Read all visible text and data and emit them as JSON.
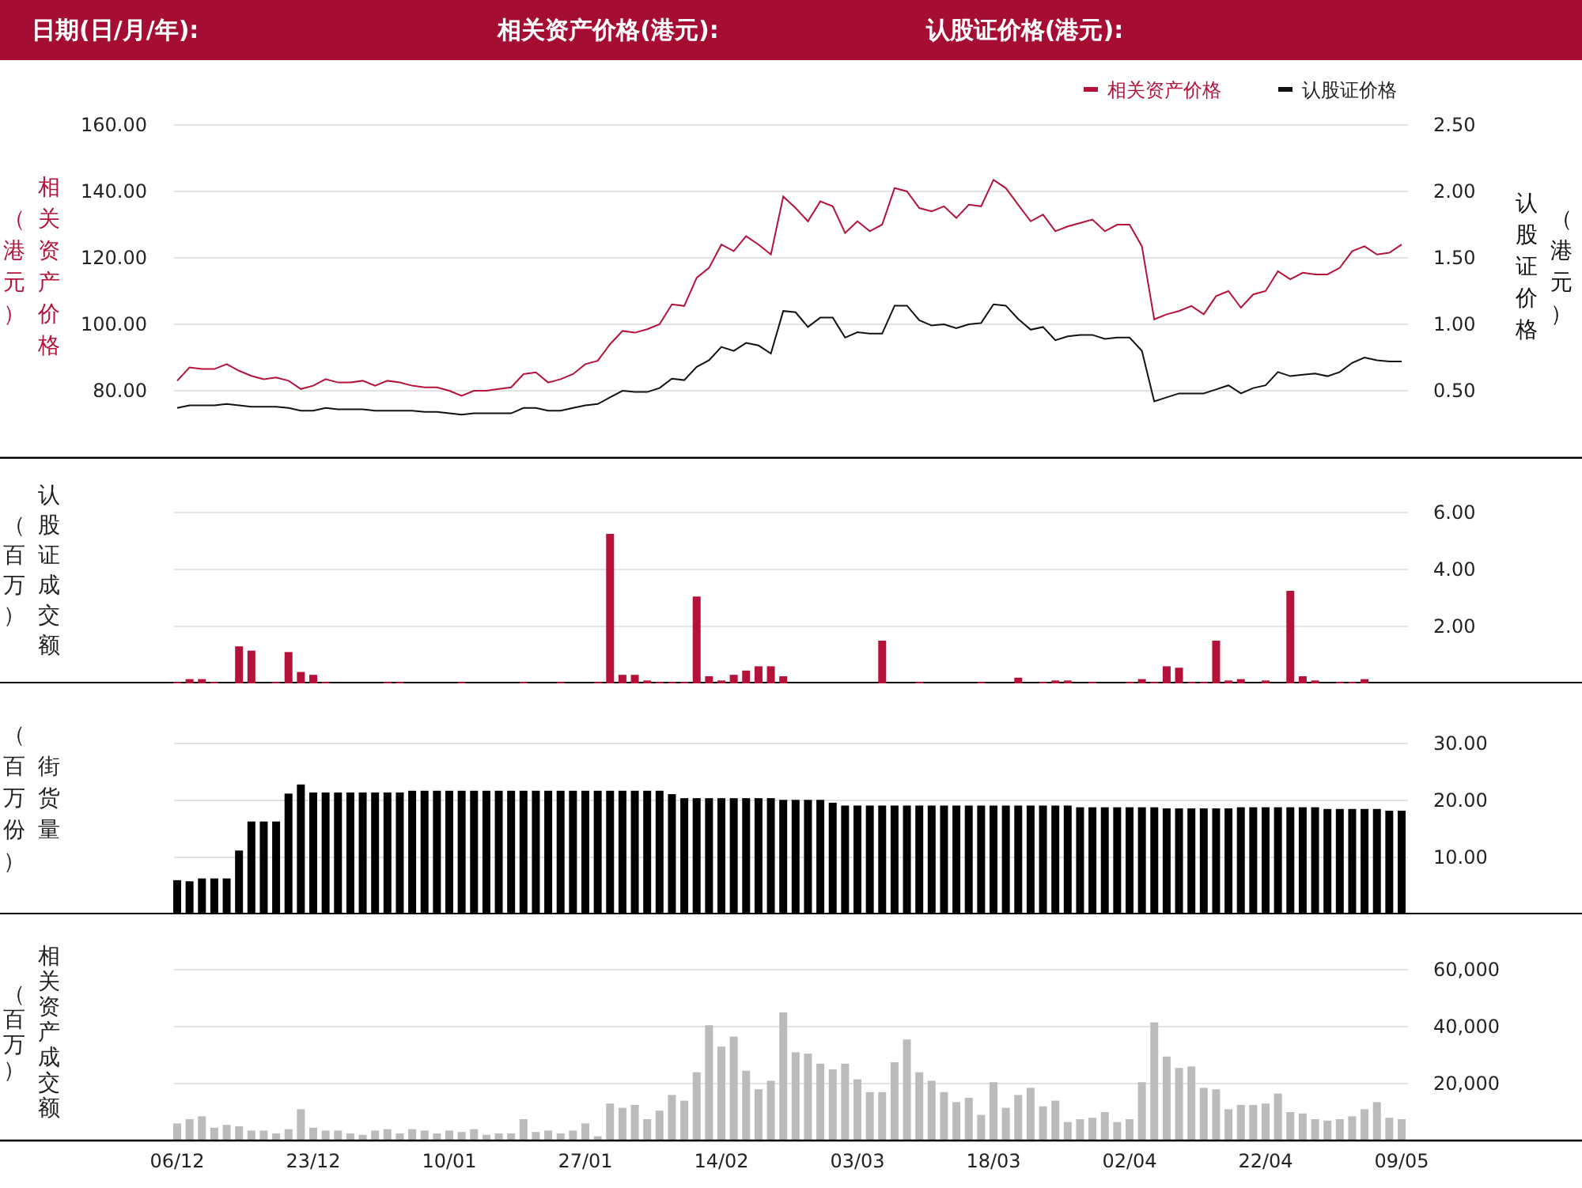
{
  "header": {
    "fields": [
      {
        "label": "日期(日/月/年):"
      },
      {
        "label": "相关资产价格(港元):"
      },
      {
        "label": "认股证价格(港元):"
      }
    ]
  },
  "price_chart": {
    "left_unit": "（港元）",
    "right_unit": "（港元）",
    "charts": [
      {
        "chart_data": {
          "type": "line",
          "ylabel": "相关资产价格",
          "legend": "top-right",
          "grid": true,
          "ylim": [
            60,
            160
          ],
          "yticks": [
            {
              "value": 80,
              "label": "80.00"
            },
            {
              "value": 100,
              "label": "100.00"
            },
            {
              "value": 120,
              "label": "120.00"
            },
            {
              "value": 140,
              "label": "140.00"
            },
            {
              "value": 160,
              "label": "160.00"
            }
          ],
          "series": [
            {
              "name": "相关资产价格",
              "color": "#b5123a",
              "values": [
                83,
                87,
                86.5,
                86.5,
                88,
                86,
                84.5,
                83.5,
                84,
                83,
                80.5,
                81.5,
                83.5,
                82.5,
                82.5,
                83,
                81.5,
                83,
                82.5,
                81.5,
                81,
                81,
                80,
                78.5,
                80,
                80,
                80.5,
                81,
                85,
                85.5,
                82.5,
                83.5,
                85,
                88,
                89,
                94,
                98,
                97.5,
                98.5,
                100,
                106,
                105.5,
                114,
                117,
                124,
                122,
                126.5,
                124,
                121,
                138.5,
                135,
                131,
                137,
                135.5,
                127.5,
                131,
                128,
                130,
                141,
                140,
                135,
                134,
                135.5,
                132,
                136,
                135.5,
                143.5,
                141,
                136,
                131,
                133,
                128,
                129.5,
                130.5,
                131.5,
                128,
                130,
                130,
                123.5,
                101.5,
                103,
                104,
                105.5,
                103,
                108.5,
                110,
                105,
                109,
                110,
                116,
                113.5,
                115.5,
                115,
                115,
                117,
                122,
                123.5,
                121,
                121.5,
                124
              ]
            }
          ]
        }
      },
      {
        "chart_data": {
          "type": "line",
          "ylabel": "认股证价格",
          "legend": "top-right",
          "ylim": [
            0,
            2.5
          ],
          "yticks": [
            {
              "value": 0.5,
              "label": "0.50"
            },
            {
              "value": 1,
              "label": "1.00"
            },
            {
              "value": 1.5,
              "label": "1.50"
            },
            {
              "value": 2,
              "label": "2.00"
            },
            {
              "value": 2.5,
              "label": "2.50"
            }
          ],
          "series": [
            {
              "name": "认股证价格",
              "color": "#111111",
              "values": [
                0.37,
                0.39,
                0.39,
                0.39,
                0.4,
                0.39,
                0.38,
                0.38,
                0.38,
                0.37,
                0.35,
                0.35,
                0.37,
                0.36,
                0.36,
                0.36,
                0.35,
                0.35,
                0.35,
                0.35,
                0.34,
                0.34,
                0.33,
                0.32,
                0.33,
                0.33,
                0.33,
                0.33,
                0.37,
                0.37,
                0.35,
                0.35,
                0.37,
                0.39,
                0.4,
                0.45,
                0.5,
                0.49,
                0.49,
                0.52,
                0.59,
                0.58,
                0.68,
                0.73,
                0.83,
                0.8,
                0.86,
                0.84,
                0.78,
                1.1,
                1.09,
                0.98,
                1.05,
                1.05,
                0.9,
                0.94,
                0.93,
                0.93,
                1.14,
                1.14,
                1.03,
                0.99,
                1,
                0.97,
                1,
                1.01,
                1.15,
                1.14,
                1.04,
                0.96,
                0.98,
                0.88,
                0.91,
                0.92,
                0.92,
                0.89,
                0.9,
                0.9,
                0.8,
                0.42,
                0.45,
                0.48,
                0.48,
                0.48,
                0.51,
                0.54,
                0.48,
                0.52,
                0.54,
                0.64,
                0.61,
                0.62,
                0.63,
                0.61,
                0.64,
                0.71,
                0.75,
                0.73,
                0.72,
                0.72
              ]
            }
          ]
        }
      }
    ]
  },
  "warrant_turnover_chart": {
    "unit": "（百万）",
    "chart_data": {
      "type": "bar",
      "ylabel": "认股证成交额",
      "grid": true,
      "ylim": [
        0,
        6
      ],
      "yticks": [
        {
          "value": 2,
          "label": "2.00"
        },
        {
          "value": 4,
          "label": "4.00"
        },
        {
          "value": 6,
          "label": "6.00"
        }
      ],
      "series": [
        {
          "color": "#b5123a",
          "values": [
            0.05,
            0.15,
            0.15,
            0.05,
            0,
            1.3,
            1.15,
            0,
            0.05,
            1.1,
            0.4,
            0.3,
            0.05,
            0,
            0,
            0,
            0,
            0.05,
            0.05,
            0,
            0,
            0,
            0,
            0.05,
            0,
            0,
            0,
            0,
            0.05,
            0,
            0,
            0.05,
            0,
            0,
            0.05,
            5.25,
            0.3,
            0.3,
            0.1,
            0.05,
            0.05,
            0.05,
            3.05,
            0.25,
            0.1,
            0.3,
            0.45,
            0.6,
            0.6,
            0.25,
            0,
            0,
            0,
            0,
            0,
            0,
            0,
            1.5,
            0,
            0,
            0.05,
            0,
            0,
            0,
            0,
            0.05,
            0,
            0,
            0.2,
            0,
            0.05,
            0.1,
            0.1,
            0,
            0.05,
            0,
            0,
            0.05,
            0.15,
            0.05,
            0.6,
            0.55,
            0.05,
            0.05,
            1.5,
            0.1,
            0.15,
            0,
            0.1,
            0,
            3.25,
            0.25,
            0.1,
            0,
            0.05,
            0.05,
            0.15,
            0,
            0,
            0
          ]
        }
      ]
    }
  },
  "outstanding_chart": {
    "unit": "（百万份）",
    "chart_data": {
      "type": "bar",
      "ylabel": "街货量",
      "grid": true,
      "ylim": [
        0,
        30
      ],
      "yticks": [
        {
          "value": 10,
          "label": "10.00"
        },
        {
          "value": 20,
          "label": "20.00"
        },
        {
          "value": 30,
          "label": "30.00"
        }
      ],
      "series": [
        {
          "color": "#000000",
          "values": [
            6,
            5.8,
            6.3,
            6.3,
            6.3,
            11.2,
            16.3,
            16.3,
            16.3,
            21.2,
            22.8,
            21.4,
            21.4,
            21.4,
            21.4,
            21.4,
            21.4,
            21.4,
            21.4,
            21.7,
            21.7,
            21.7,
            21.7,
            21.7,
            21.7,
            21.7,
            21.7,
            21.7,
            21.7,
            21.7,
            21.7,
            21.7,
            21.7,
            21.7,
            21.7,
            21.7,
            21.7,
            21.7,
            21.7,
            21.7,
            21.1,
            20.4,
            20.4,
            20.4,
            20.4,
            20.4,
            20.4,
            20.4,
            20.4,
            20.1,
            20.1,
            20.1,
            20.1,
            19.6,
            19.1,
            19.1,
            19.1,
            19.1,
            19.1,
            19.1,
            19.1,
            19.1,
            19.1,
            19.1,
            19.1,
            19.1,
            19.1,
            19.1,
            19.1,
            19.1,
            19.1,
            19.1,
            19.1,
            18.8,
            18.8,
            18.8,
            18.8,
            18.8,
            18.8,
            18.8,
            18.6,
            18.6,
            18.6,
            18.6,
            18.6,
            18.6,
            18.8,
            18.8,
            18.8,
            18.8,
            18.8,
            18.8,
            18.8,
            18.5,
            18.5,
            18.5,
            18.5,
            18.5,
            18.2,
            18.2
          ]
        }
      ]
    }
  },
  "asset_turnover_chart": {
    "unit": "（百万）",
    "date_labels": [
      "06/12",
      "23/12",
      "10/01",
      "27/01",
      "14/02",
      "03/03",
      "18/03",
      "02/04",
      "22/04",
      "09/05"
    ],
    "chart_data": {
      "type": "bar",
      "ylabel": "相关资产成交额",
      "grid": true,
      "ylim": [
        0,
        60000
      ],
      "yticks": [
        {
          "value": 20000,
          "label": "20,000"
        },
        {
          "value": 40000,
          "label": "40,000"
        },
        {
          "value": 60000,
          "label": "60,000"
        }
      ],
      "series": [
        {
          "color": "#bbbbbb",
          "values": [
            6000,
            7500,
            8500,
            4500,
            5500,
            5000,
            3500,
            3500,
            2500,
            4000,
            11000,
            4500,
            3500,
            3500,
            2500,
            2000,
            3500,
            4000,
            2500,
            4000,
            3500,
            2500,
            3500,
            3000,
            4000,
            2000,
            2500,
            2500,
            7500,
            3000,
            3500,
            2500,
            3500,
            6000,
            1500,
            13000,
            11500,
            12500,
            7500,
            10500,
            16000,
            14000,
            24000,
            40500,
            33000,
            36500,
            24500,
            18000,
            21000,
            45000,
            31000,
            30500,
            27000,
            25000,
            27000,
            21500,
            17000,
            17000,
            27500,
            35500,
            24000,
            21000,
            17000,
            13500,
            15000,
            9000,
            20500,
            11500,
            16000,
            18500,
            12000,
            14000,
            6500,
            7500,
            8000,
            10000,
            6500,
            7500,
            20500,
            41500,
            29500,
            25500,
            26000,
            18500,
            18000,
            11000,
            12500,
            12500,
            13000,
            16500,
            10000,
            9500,
            7500,
            7000,
            7500,
            8500,
            11000,
            13500,
            8000,
            7500
          ]
        }
      ]
    }
  }
}
